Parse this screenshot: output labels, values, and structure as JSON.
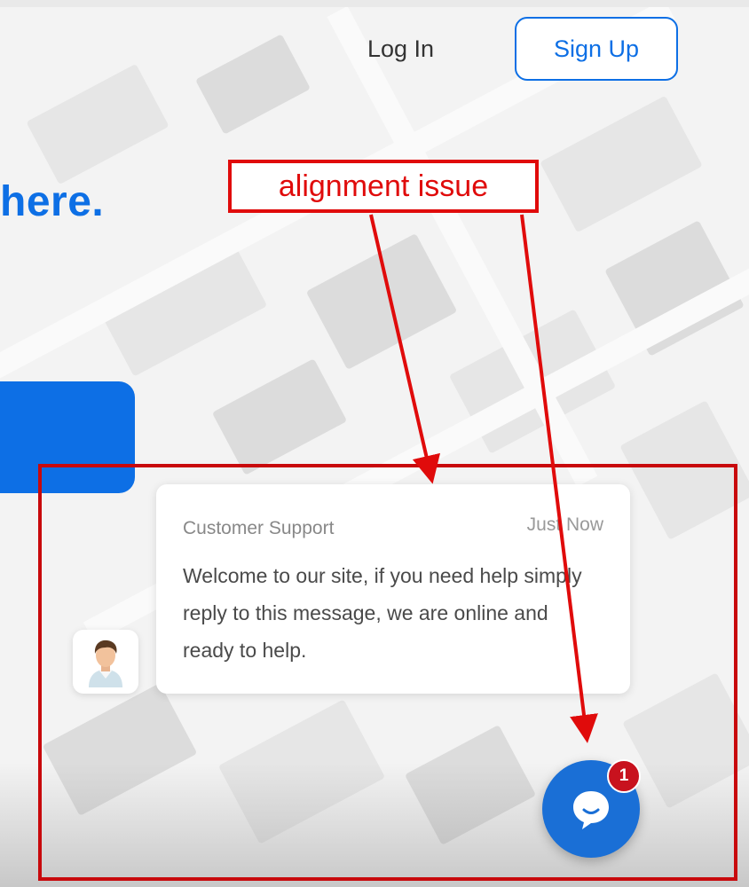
{
  "header": {
    "login_label": "Log In",
    "signup_label": "Sign Up"
  },
  "hero": {
    "headline_fragment": "here."
  },
  "annotation": {
    "label": "alignment issue",
    "color": "#e00b0b"
  },
  "chat_popup": {
    "sender": "Customer Support",
    "time": "Just Now",
    "message": "Welcome to our site, if you need help simply reply to this message, we are online and ready to help.",
    "avatar_icon": "user-avatar-icon"
  },
  "chat_launcher": {
    "icon": "chat-bubble-icon",
    "unread_count": "1",
    "color": "#1a6fd6"
  },
  "colors": {
    "brand_blue": "#0d6fe5",
    "badge_red": "#c8121e"
  }
}
